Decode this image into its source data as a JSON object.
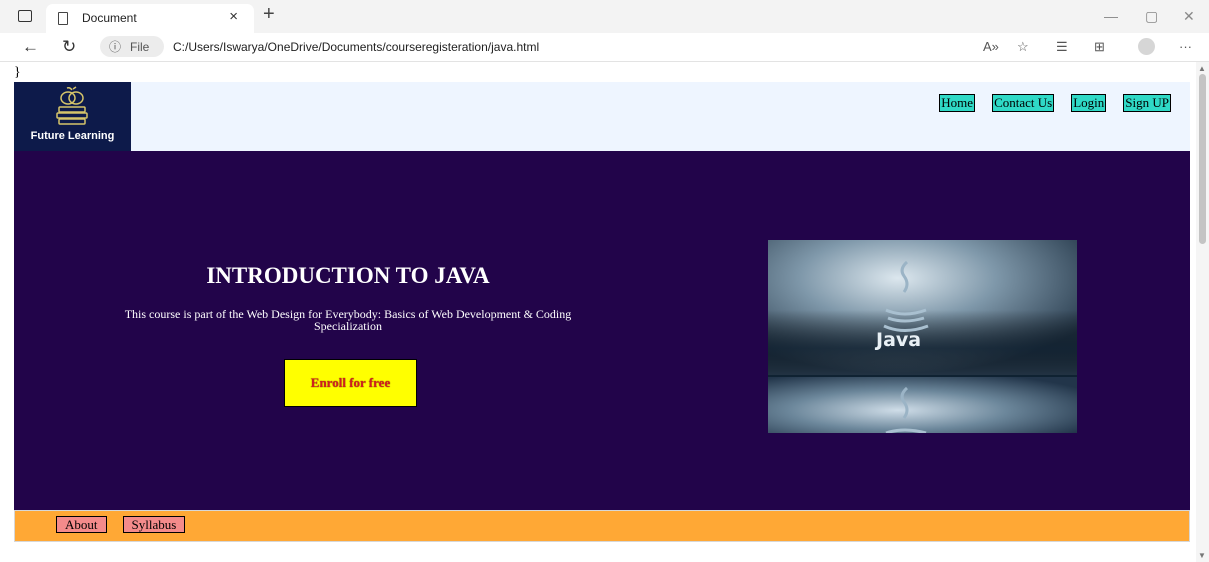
{
  "browser": {
    "tab_title": "Document",
    "tab_close": "×",
    "new_tab": "+",
    "url_prefix": "File",
    "url": "C:/Users/Iswarya/OneDrive/Documents/courseregisteration/java.html"
  },
  "page": {
    "stray_text": "}",
    "logo_text": "Future Learning",
    "nav": [
      {
        "label": "Home"
      },
      {
        "label": "Contact Us"
      },
      {
        "label": "Login"
      },
      {
        "label": "Sign UP"
      }
    ],
    "hero": {
      "title": "INTRODUCTION TO JAVA",
      "description": "This course is part of the Web Design for Everybody: Basics of Web Development & Coding Specialization",
      "button": "Enroll for free",
      "image_text": "Java"
    },
    "footer": [
      {
        "label": "About"
      },
      {
        "label": "Syllabus"
      }
    ]
  },
  "colors": {
    "header_bg": "#eef5ff",
    "logo_bg": "#0d1a4a",
    "nav_button": "#2fd9c6",
    "hero_bg": "#22044a",
    "enroll_bg": "#ffff00",
    "enroll_text": "#d21f1f",
    "footer_bg": "#ffa835",
    "footer_button": "#f48b8b"
  }
}
